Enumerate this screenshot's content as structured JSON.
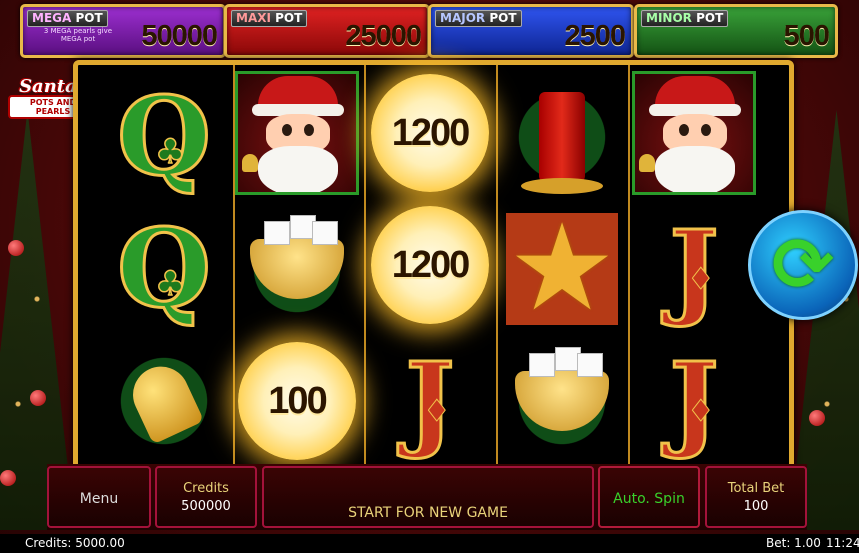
{
  "jackpots": [
    {
      "label_a": "MEGA",
      "label_b": "POT",
      "value": "50000",
      "note": "3 MEGA pearls give MEGA pot",
      "color": "#7b1fa2"
    },
    {
      "label_a": "MAXI",
      "label_b": "POT",
      "value": "25000",
      "color": "#c81414"
    },
    {
      "label_a": "MAJOR",
      "label_b": "POT",
      "value": "2500",
      "color": "#1c3fd6"
    },
    {
      "label_a": "MINOR",
      "label_b": "POT",
      "value": "500",
      "color": "#2a8a2a"
    }
  ],
  "logo": {
    "line1": "Santas",
    "line2": "POTS AND PEARLS"
  },
  "reels": {
    "pearl_values": [
      "1200",
      "1200",
      "100"
    ],
    "symbols": [
      [
        "q-symbol",
        "q-symbol",
        "bell-symbol"
      ],
      [
        "santa-symbol",
        "sugar-bowl-symbol",
        "pearl-symbol"
      ],
      [
        "pearl-symbol",
        "pearl-symbol",
        "j-symbol"
      ],
      [
        "candle-symbol",
        "star-symbol",
        "sugar-bowl-symbol"
      ],
      [
        "santa-symbol",
        "j-symbol",
        "j-symbol"
      ]
    ]
  },
  "controls": {
    "menu": "Menu",
    "credits_label": "Credits",
    "credits_value": "500000",
    "start": "START FOR NEW GAME",
    "autospin": "Auto. Spin",
    "total_bet_label": "Total Bet",
    "total_bet_value": "100"
  },
  "status_bar": {
    "credits": "Credits: 5000.00",
    "bet": "Bet: 1.00",
    "time": "11:24"
  },
  "letters": {
    "q": "Q",
    "j": "J",
    "club": "♣",
    "diamond": "♦",
    "star": "★",
    "spin": "⟳"
  }
}
